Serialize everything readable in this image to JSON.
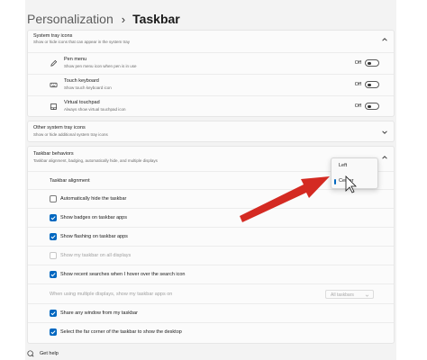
{
  "breadcrumb": {
    "parent": "Personalization",
    "separator": "›",
    "current": "Taskbar"
  },
  "system_tray_icons": {
    "title": "System tray icons",
    "subtitle": "Show or hide icons that can appear in the system tray",
    "items": [
      {
        "icon": "pen-icon",
        "title": "Pen menu",
        "subtitle": "Show pen menu icon when pen is in use",
        "state": "Off"
      },
      {
        "icon": "keyboard-icon",
        "title": "Touch keyboard",
        "subtitle": "Show touch keyboard icon",
        "state": "Off"
      },
      {
        "icon": "touchpad-icon",
        "title": "Virtual touchpad",
        "subtitle": "Always show virtual touchpad icon",
        "state": "Off"
      }
    ]
  },
  "other_tray_icons": {
    "title": "Other system tray icons",
    "subtitle": "Show or hide additional system tray icons"
  },
  "behaviors": {
    "title": "Taskbar behaviors",
    "subtitle": "Taskbar alignment, badging, automatically hide, and multiple displays",
    "alignment_label": "Taskbar alignment",
    "alignment_options": [
      "Left",
      "Center"
    ],
    "alignment_selected": "Center",
    "options": [
      {
        "label": "Automatically hide the taskbar",
        "checked": false,
        "disabled": false
      },
      {
        "label": "Show badges on taskbar apps",
        "checked": true,
        "disabled": false
      },
      {
        "label": "Show flashing on taskbar apps",
        "checked": true,
        "disabled": false
      },
      {
        "label": "Show my taskbar on all displays",
        "checked": false,
        "disabled": true
      },
      {
        "label": "Show recent searches when I hover over the search icon",
        "checked": true,
        "disabled": false
      }
    ],
    "multi_display_label": "When using multiple displays, show my taskbar apps on",
    "multi_display_value": "All taskbars",
    "options_after": [
      {
        "label": "Share any window from my taskbar",
        "checked": true,
        "disabled": false
      },
      {
        "label": "Select the far corner of the taskbar to show the desktop",
        "checked": true,
        "disabled": false
      }
    ]
  },
  "help": {
    "label": "Get help"
  },
  "colors": {
    "accent": "#0067c0",
    "arrow": "#d42a22",
    "background": "#f3f3f3"
  }
}
